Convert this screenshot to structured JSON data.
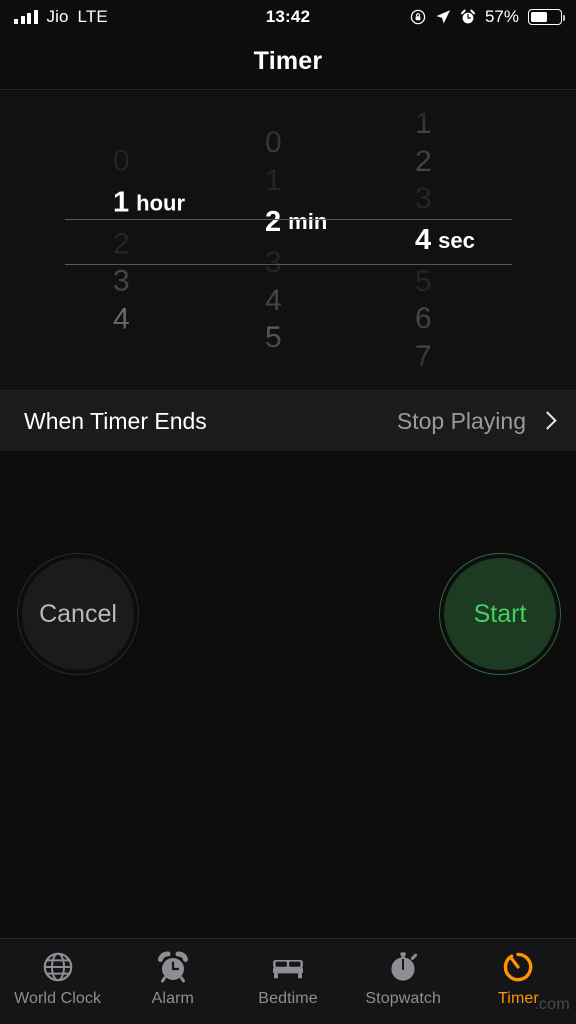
{
  "status_bar": {
    "carrier": "Jio",
    "network": "LTE",
    "time": "13:42",
    "battery_percent": "57%",
    "battery_level": 57,
    "icons": [
      "signal-bars-icon",
      "rotation-lock-icon",
      "location-arrow-icon",
      "alarm-icon",
      "battery-icon"
    ]
  },
  "nav": {
    "title": "Timer"
  },
  "picker": {
    "hours": {
      "label": "hour",
      "selected": "1",
      "above": [
        "0"
      ],
      "below": [
        "2",
        "3",
        "4"
      ]
    },
    "minutes": {
      "label": "min",
      "selected": "2",
      "above": [
        "0",
        "1"
      ],
      "below": [
        "3",
        "4",
        "5"
      ]
    },
    "seconds": {
      "label": "sec",
      "selected": "4",
      "above": [
        "1",
        "2",
        "3"
      ],
      "below": [
        "5",
        "6",
        "7"
      ]
    }
  },
  "when_timer_ends": {
    "label": "When Timer Ends",
    "value": "Stop Playing",
    "chevron": "chevron-right-icon"
  },
  "actions": {
    "cancel_label": "Cancel",
    "start_label": "Start",
    "start_color": "#43d163",
    "cancel_color": "#b9b9bd"
  },
  "tab_bar": {
    "active": "Timer",
    "accent": "#ff9500",
    "inactive_color": "#8e8e93",
    "items": [
      {
        "label": "World Clock",
        "icon": "globe-icon"
      },
      {
        "label": "Alarm",
        "icon": "alarm-clock-icon"
      },
      {
        "label": "Bedtime",
        "icon": "bed-icon"
      },
      {
        "label": "Stopwatch",
        "icon": "stopwatch-icon"
      },
      {
        "label": "Timer",
        "icon": "timer-icon"
      }
    ]
  },
  "watermark": {
    "text": ".com"
  }
}
